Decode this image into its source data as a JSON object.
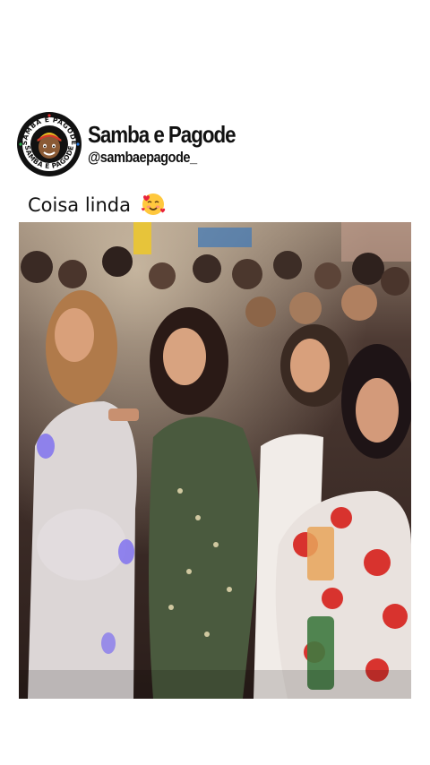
{
  "post": {
    "account_name": "Samba e Pagode",
    "account_handle": "@sambaepagode_",
    "logo": {
      "ring_text_top": "SAMBA E PAGODE",
      "ring_text_bottom": "SAMBA E PAGODE",
      "icon": "samba-pagode-logo-icon"
    },
    "caption": "Coisa linda",
    "caption_emoji": "smiling-face-with-hearts-icon"
  },
  "video": {
    "icon": "video-frame-crowd-at-party"
  },
  "colors": {
    "background": "#ffffff",
    "text": "#111111"
  }
}
